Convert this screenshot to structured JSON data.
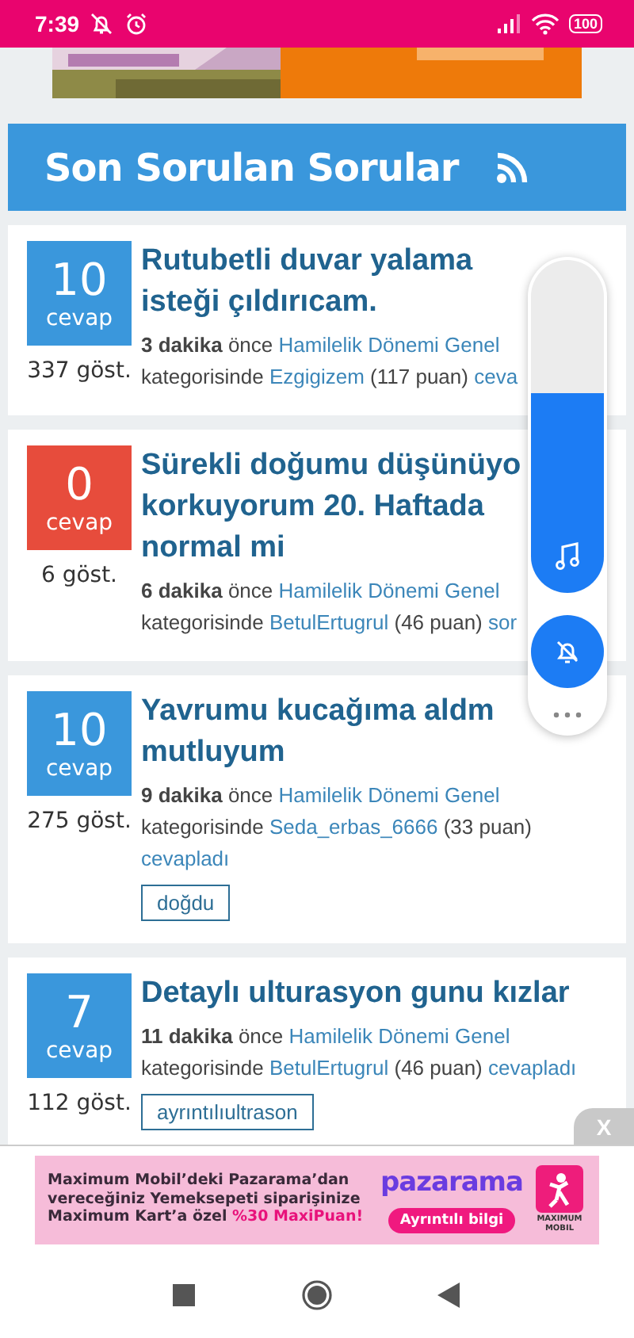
{
  "status_bar": {
    "time": "7:39",
    "battery": "100"
  },
  "section": {
    "title": "Son Sorulan Sorular"
  },
  "questions": [
    {
      "answers": "10",
      "answers_label": "cevap",
      "color": "#3a97dc",
      "views": "337 göst.",
      "title": "Rutubetli duvar yalama isteği çıldırıcam.",
      "time": "3 dakika",
      "ago": "önce",
      "category": "Hamilelik Dönemi Genel",
      "in_label": "kategorisinde",
      "user": "Ezgigizem",
      "points": "(117 puan)",
      "action": "ceva"
    },
    {
      "answers": "0",
      "answers_label": "cevap",
      "color": "#e74c3c",
      "views": "6 göst.",
      "title": "Sürekli doğumu düşünüyo korkuyorum 20. Haftada normal mi",
      "time": "6 dakika",
      "ago": "önce",
      "category": "Hamilelik Dönemi Genel",
      "in_label": "kategorisinde",
      "user": "BetulErtugrul",
      "points": "(46 puan)",
      "action": "sor"
    },
    {
      "answers": "10",
      "answers_label": "cevap",
      "color": "#3a97dc",
      "views": "275 göst.",
      "title": "Yavrumu kucağıma aldm mutluyum",
      "time": "9 dakika",
      "ago": "önce",
      "category": "Hamilelik Dönemi Genel",
      "in_label": "kategorisinde",
      "user": "Seda_erbas_6666",
      "points": "(33 puan)",
      "action": "cevapladı",
      "tags": [
        "doğdu"
      ]
    },
    {
      "answers": "7",
      "answers_label": "cevap",
      "color": "#3a97dc",
      "views": "112 göst.",
      "title": "Detaylı ulturasyon gunu kızlar",
      "time": "11 dakika",
      "ago": "önce",
      "category": "Hamilelik Dönemi Genel",
      "in_label": "kategorisinde",
      "user": "BetulErtugrul",
      "points": "(46 puan)",
      "action": "cevapladı",
      "tags": [
        "ayrıntılıultrason"
      ]
    }
  ],
  "volume": {
    "level": 0.6
  },
  "bottom_ad": {
    "close": "X",
    "text": "Maximum Mobil’deki Pazarama’dan vereceğiniz Yemeksepeti siparişinize Maximum Kart’a özel",
    "highlight": "%30 MaxiPuan!",
    "brand": "pazarama",
    "button": "Ayrıntılı bilgi",
    "logo_text": "MAXIMUM MOBIL"
  }
}
